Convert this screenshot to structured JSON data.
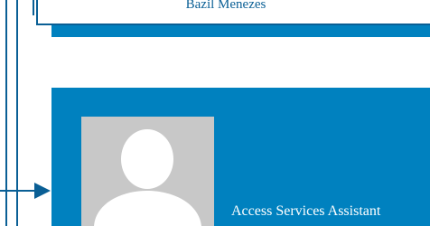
{
  "cards": [
    {
      "name": "Bazil Menezes"
    },
    {
      "title": "Access Services Assistant"
    }
  ],
  "icons": {
    "photo": "default-avatar-icon",
    "connector_arrow": "arrow-right-icon"
  },
  "colors": {
    "card_blue": "#0081bf",
    "line_blue": "#0a5f95",
    "text_on_blue": "#ffffff",
    "photo_gray": "#c8c8c8"
  }
}
